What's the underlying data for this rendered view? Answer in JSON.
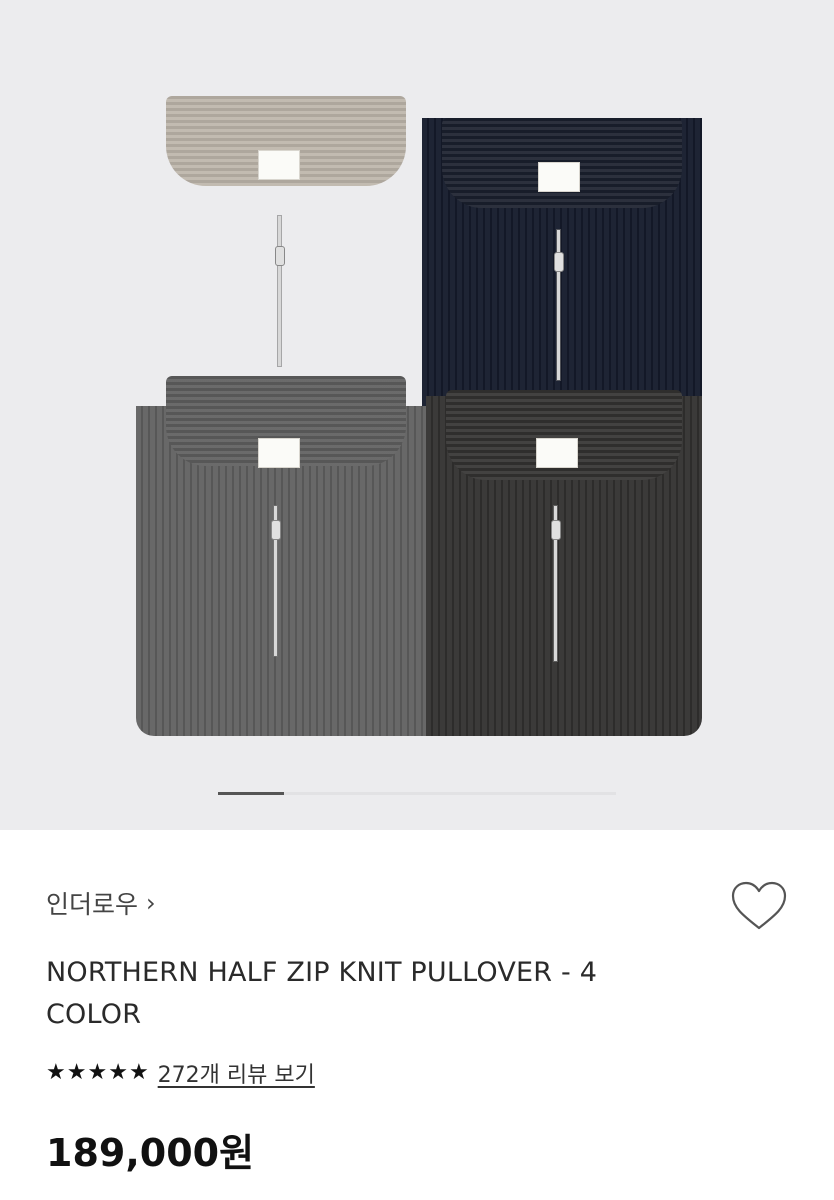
{
  "gallery": {
    "colors": {
      "beige": "#cbc3b9",
      "navy": "#1e2434",
      "grey": "#686868",
      "charcoal": "#3b3a39"
    },
    "slide_indicator": {
      "current": 1
    }
  },
  "product": {
    "brand": "인더로우",
    "brand_chevron": "›",
    "favorite_icon": "heart-outline-icon",
    "title": "NORTHERN HALF ZIP KNIT PULLOVER - 4 COLOR",
    "rating_stars": 5,
    "review_link": "272개 리뷰 보기",
    "price": "189,000원"
  }
}
